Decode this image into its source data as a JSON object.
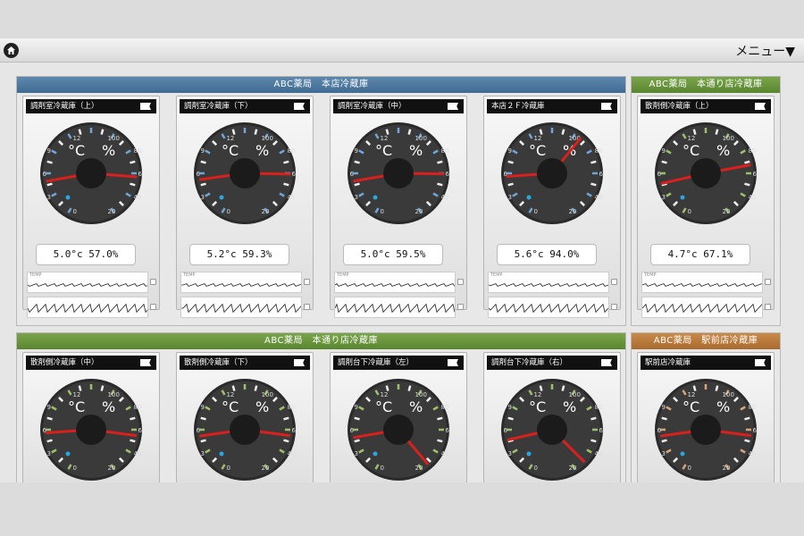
{
  "header": {
    "menu_label": "メニュー▼",
    "home_icon": "home-icon"
  },
  "sections": [
    {
      "title": "ABC薬局　本店冷蔵庫",
      "color": "blue"
    },
    {
      "title": "ABC薬局　本通り店冷蔵庫",
      "color": "green"
    },
    {
      "title": "ABC薬局　本通り店冷蔵庫",
      "color": "green"
    },
    {
      "title": "ABC薬局　駅前店冷蔵庫",
      "color": "orange"
    }
  ],
  "gauge_labels": {
    "temp_unit": "°C",
    "hum_unit": "%",
    "temp_ticks": [
      "12",
      "9",
      "6",
      "3",
      "0"
    ],
    "hum_ticks": [
      "100",
      "80",
      "60",
      "40",
      "20"
    ],
    "graph_label": "TEMP"
  },
  "panels": [
    {
      "title": "調剤室冷蔵庫（上）",
      "readout": "5.0°c  57.0%",
      "temp": 5.0,
      "hum": 57.0,
      "scale_color": "#6ea6d9"
    },
    {
      "title": "調剤室冷蔵庫（下）",
      "readout": "5.2°c  59.3%",
      "temp": 5.2,
      "hum": 59.3,
      "scale_color": "#6ea6d9"
    },
    {
      "title": "調剤室冷蔵庫（中）",
      "readout": "5.0°c  59.5%",
      "temp": 5.0,
      "hum": 59.5,
      "scale_color": "#6ea6d9"
    },
    {
      "title": "本店２Ｆ冷蔵庫",
      "readout": "5.6°c  94.0%",
      "temp": 5.6,
      "hum": 94.0,
      "scale_color": "#6ea6d9"
    },
    {
      "title": "散剤側冷蔵庫（上）",
      "readout": "4.7°c  67.1%",
      "temp": 4.7,
      "hum": 67.1,
      "scale_color": "#9bc26a"
    },
    {
      "title": "散剤側冷蔵庫（中）",
      "readout": "",
      "temp": 5.6,
      "hum": 55.0,
      "scale_color": "#9bc26a"
    },
    {
      "title": "散剤側冷蔵庫（下）",
      "readout": "",
      "temp": 5.2,
      "hum": 55.0,
      "scale_color": "#9bc26a"
    },
    {
      "title": "調剤台下冷蔵庫（左）",
      "readout": "",
      "temp": 5.0,
      "hum": 27.0,
      "scale_color": "#9bc26a"
    },
    {
      "title": "調剤台下冷蔵庫（右）",
      "readout": "",
      "temp": 4.7,
      "hum": 30.0,
      "scale_color": "#9bc26a"
    },
    {
      "title": "駅前店冷蔵庫",
      "readout": "",
      "temp": 5.2,
      "hum": 55.0,
      "scale_color": "#d9a47a"
    }
  ]
}
